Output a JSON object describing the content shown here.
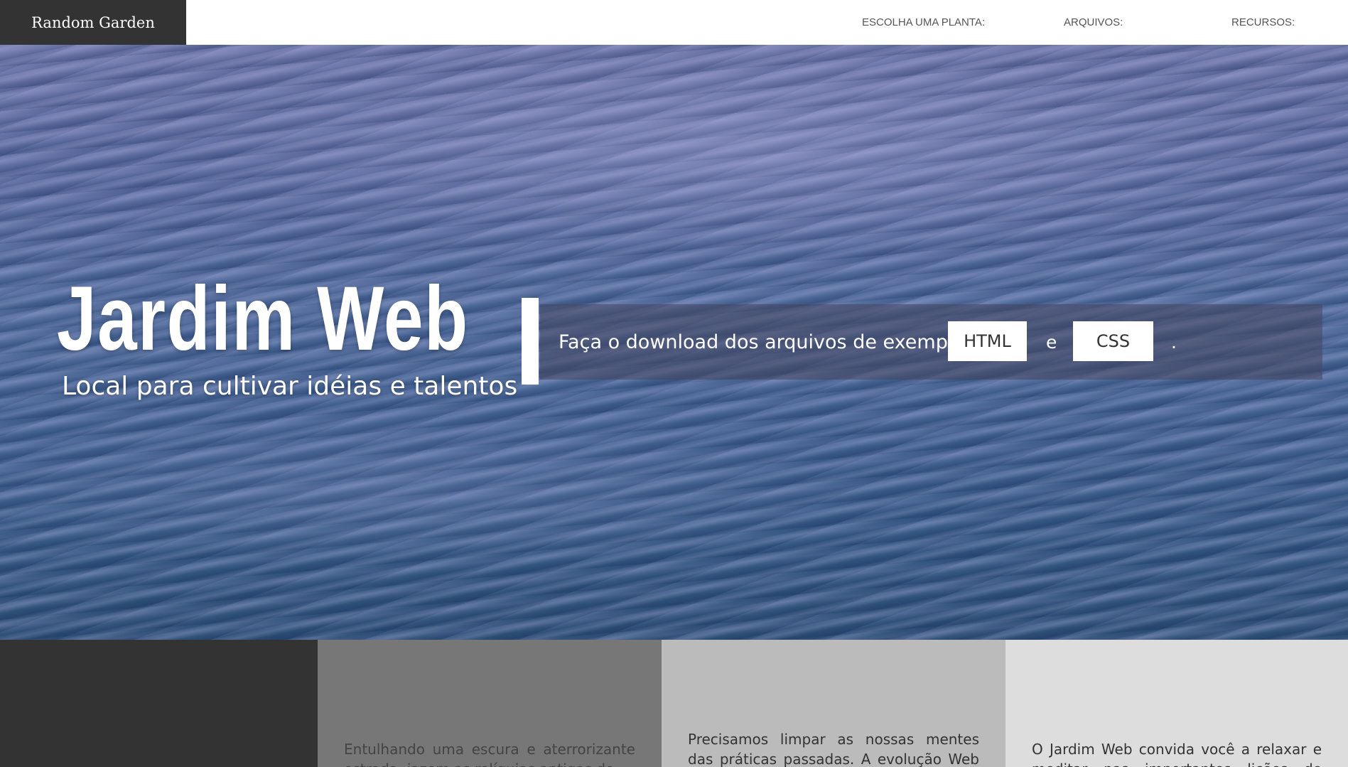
{
  "header": {
    "brand": "Random Garden",
    "nav": [
      {
        "label": "ESCOLHA UMA PLANTA:"
      },
      {
        "label": "ARQUIVOS:"
      },
      {
        "label": "RECURSOS:"
      }
    ]
  },
  "hero": {
    "title": "Jardim Web",
    "subtitle": "Local para cultivar idéias e talentos",
    "download": {
      "text": "Faça o download dos arquivos de exemplo",
      "html_button": "HTML",
      "conjunction": "e",
      "css_button": "CSS",
      "end": "."
    }
  },
  "columns": [
    {
      "text": ""
    },
    {
      "text": "Entulhando uma escura e aterrorizante estrada, jazem as relíquias antigas do"
    },
    {
      "text": "Precisamos limpar as nossas mentes das práticas passadas. A evolução Web foi"
    },
    {
      "text": "O Jardim Web convida você a relaxar e meditar nas importantes lições de Mestres"
    }
  ],
  "colors": {
    "brand_bg": "#333333",
    "panel_bg": "rgba(70,70,95,0.55)",
    "col_1": "#333333",
    "col_2": "#777777",
    "col_3": "#bbbbbb",
    "col_4": "#dddddd"
  }
}
